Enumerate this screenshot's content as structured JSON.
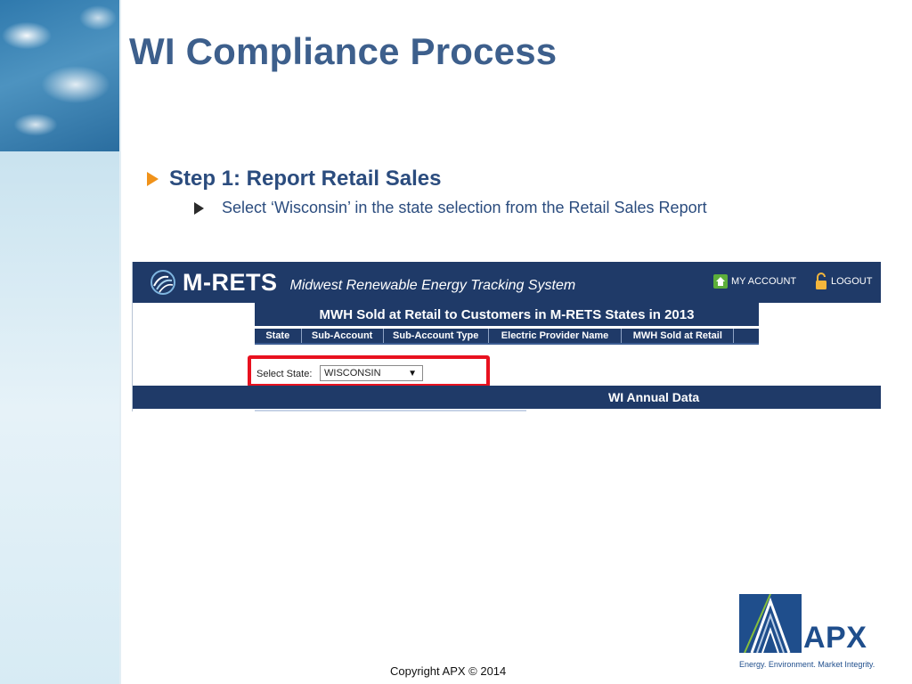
{
  "slide": {
    "title": "WI Compliance Process",
    "bullet1": "Step 1: Report Retail Sales",
    "bullet2": "Select ‘Wisconsin’ in the state selection from the Retail Sales Report",
    "copyright": "Copyright APX © 2014"
  },
  "mrets": {
    "logo_text": "M-RETS",
    "subtitle": "Midwest Renewable Energy Tracking System",
    "my_account": "MY ACCOUNT",
    "logout": "LOGOUT",
    "report_title": "MWH Sold at Retail to Customers in M-RETS States in 2013",
    "columns": [
      "State",
      "Sub-Account",
      "Sub-Account Type",
      "Electric Provider Name",
      "MWH  Sold at Retail"
    ],
    "state_label": "Select State:",
    "state_value": "WISCONSIN",
    "annual_title": "WI Annual Data"
  },
  "apx": {
    "name": "APX",
    "tagline": "Energy. Environment. Market Integrity."
  },
  "colors": {
    "title": "#3d5f8c",
    "bullet_arrow": "#f0921a",
    "mrets_navy": "#1f3a68",
    "highlight_red": "#e8111f",
    "apx_blue": "#1f4e8c"
  }
}
